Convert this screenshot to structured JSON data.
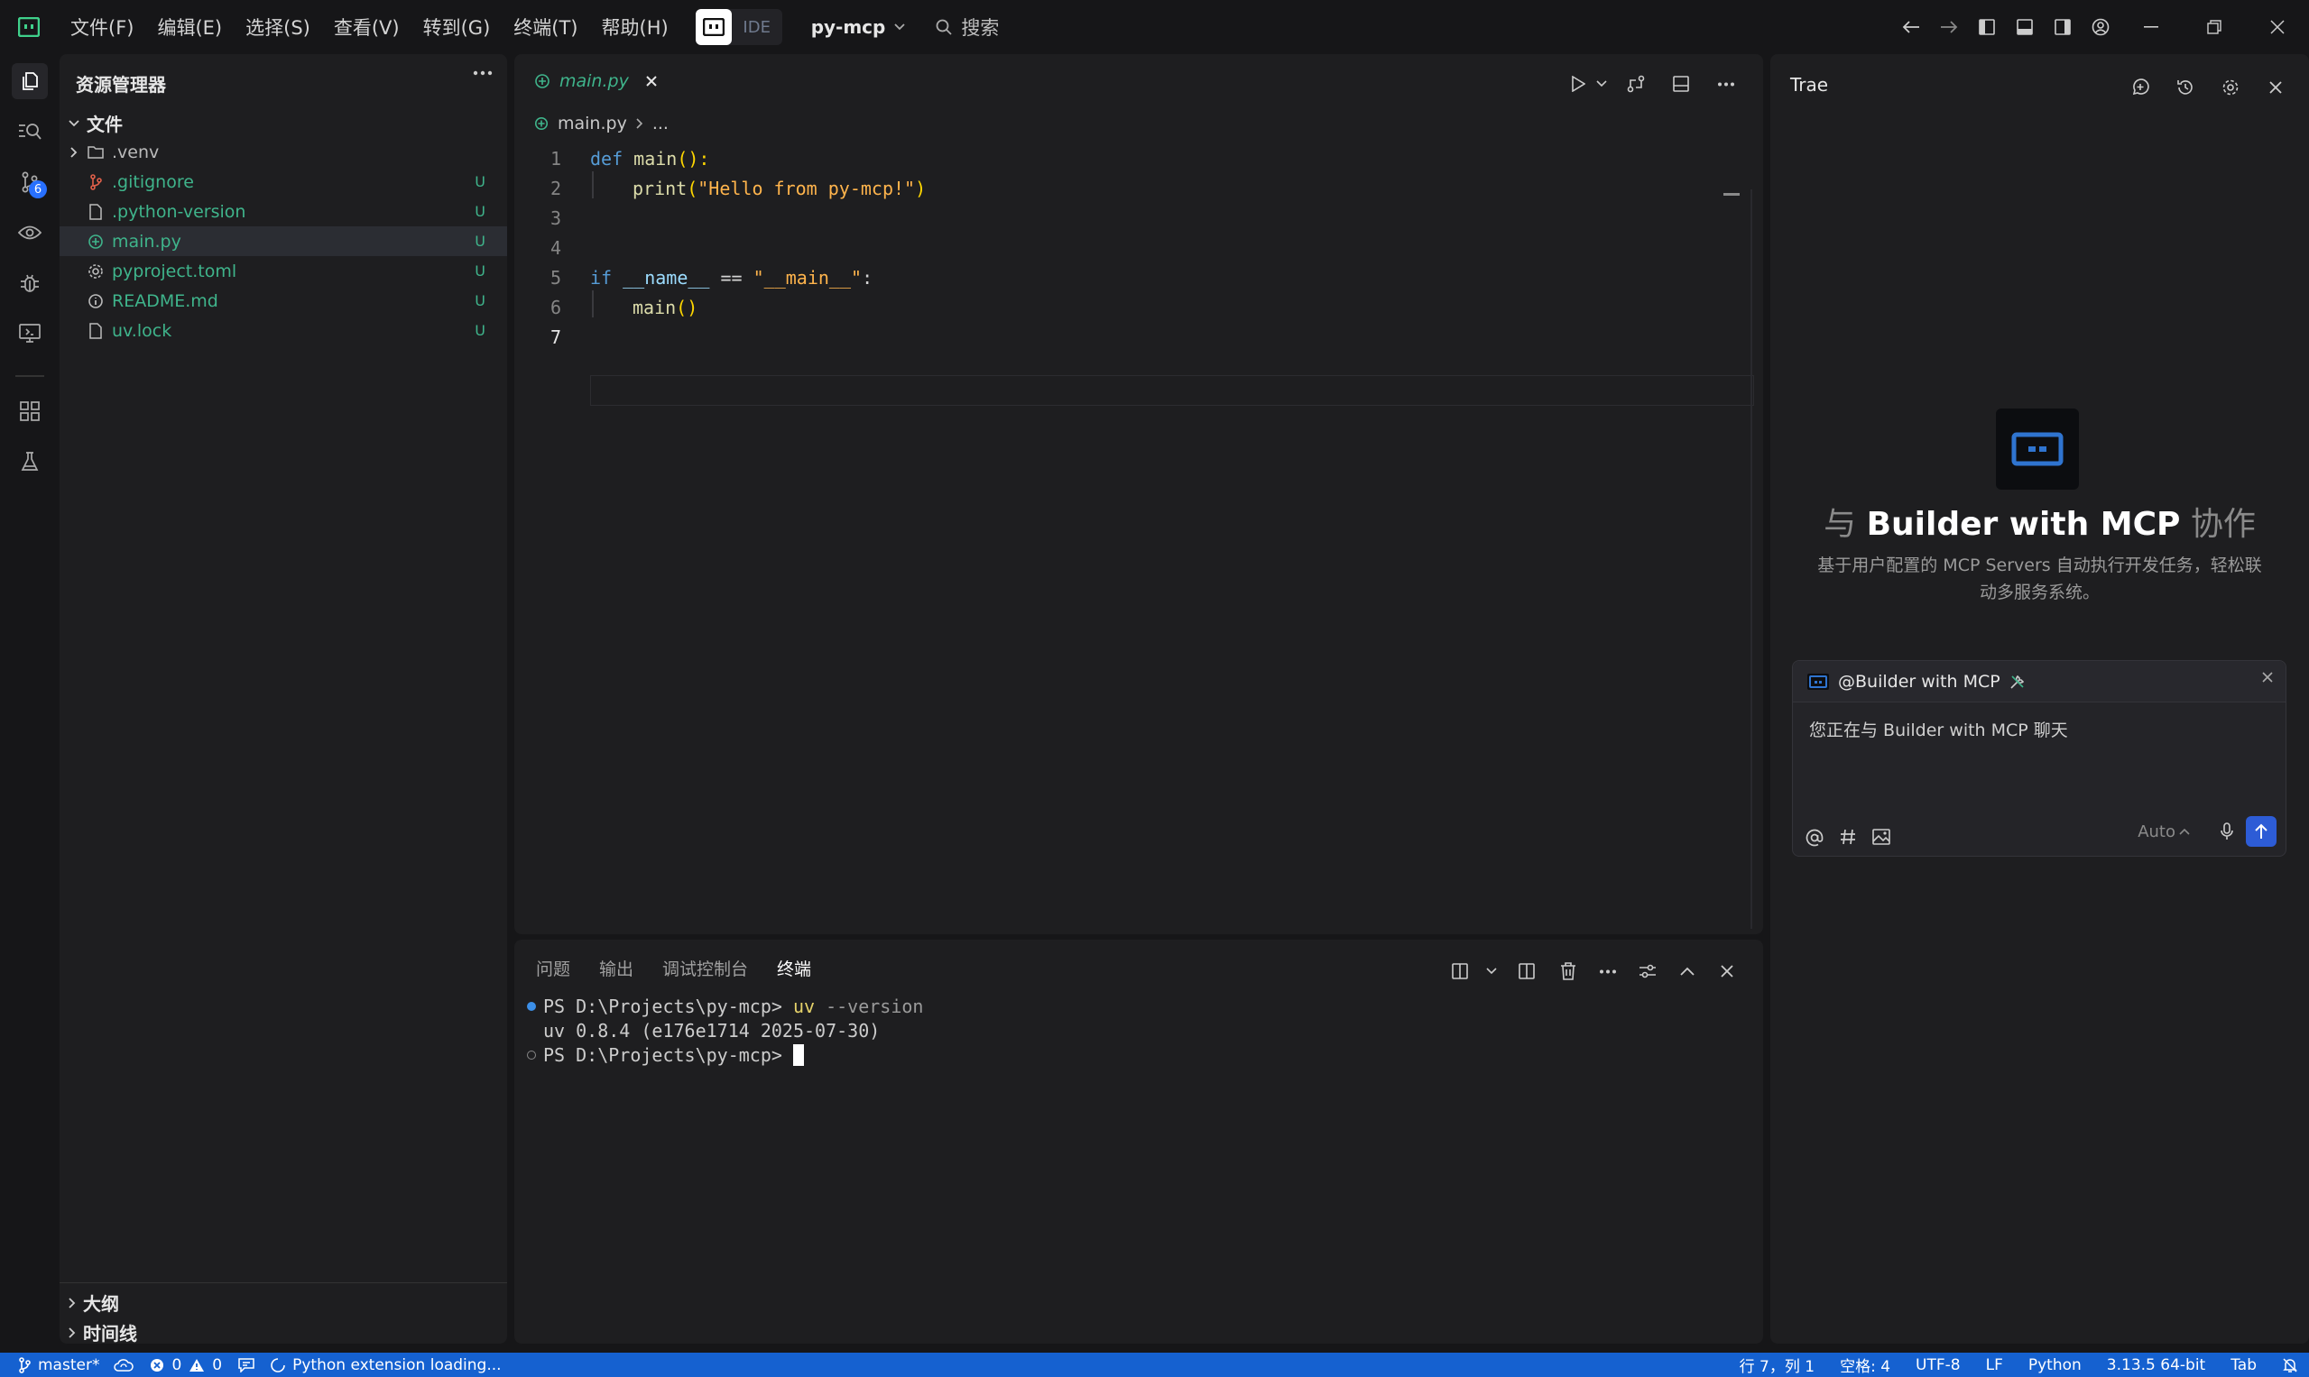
{
  "titlebar": {
    "menu": [
      "文件(F)",
      "编辑(E)",
      "选择(S)",
      "查看(V)",
      "转到(G)",
      "终端(T)",
      "帮助(H)"
    ],
    "mode_ide": "IDE",
    "project": "py-mcp",
    "search": "搜索"
  },
  "activity": {
    "scm_badge": "6"
  },
  "sidebar": {
    "title": "资源管理器",
    "root": "文件",
    "files": [
      {
        "name": ".venv",
        "status": ""
      },
      {
        "name": ".gitignore",
        "status": "U"
      },
      {
        "name": ".python-version",
        "status": "U"
      },
      {
        "name": "main.py",
        "status": "U"
      },
      {
        "name": "pyproject.toml",
        "status": "U"
      },
      {
        "name": "README.md",
        "status": "U"
      },
      {
        "name": "uv.lock",
        "status": "U"
      }
    ],
    "outline": "大纲",
    "timeline": "时间线"
  },
  "editor": {
    "tab": "main.py",
    "breadcrumb_file": "main.py",
    "breadcrumb_more": "...",
    "line_numbers": [
      "1",
      "2",
      "3",
      "4",
      "5",
      "6",
      "7"
    ],
    "code": {
      "l1_kw": "def",
      "l1_fn": "main",
      "l1_p": "():",
      "l2_fn": "print",
      "l2_open": "(",
      "l2_str": "\"Hello from py-mcp!\"",
      "l2_close": ")",
      "l5_kw": "if",
      "l5_id": "__name__",
      "l5_op": " == ",
      "l5_str": "\"__main__\"",
      "l5_p": ":",
      "l6_fn": "main",
      "l6_p": "()"
    }
  },
  "panel": {
    "tabs": [
      "问题",
      "输出",
      "调试控制台",
      "终端"
    ],
    "terminal": {
      "prompt1": "PS D:\\Projects\\py-mcp> ",
      "cmd": "uv",
      "arg": " --version",
      "out": "uv 0.8.4 (e176e1714 2025-07-30)",
      "prompt2": "PS D:\\Projects\\py-mcp> "
    }
  },
  "ai": {
    "title": "Trae",
    "heading_pre": "与 ",
    "heading_main": "Builder with MCP",
    "heading_post": " 协作",
    "subtitle": "基于用户配置的 MCP Servers 自动执行开发任务，轻松联动多服务系统。",
    "agent_tag": "@Builder with MCP",
    "input_text": "您正在与 Builder with MCP 聊天",
    "model": "Auto"
  },
  "status": {
    "branch": "master*",
    "errors": "0",
    "warnings": "0",
    "loading": "Python extension loading...",
    "position": "行 7，列 1",
    "spaces": "空格: 4",
    "encoding": "UTF-8",
    "eol": "LF",
    "language": "Python",
    "interpreter": "3.13.5 64-bit",
    "indent": "Tab"
  },
  "colors": {
    "accent": "#1561d0",
    "untracked": "#3fb48b",
    "send": "#2d5cd6"
  }
}
